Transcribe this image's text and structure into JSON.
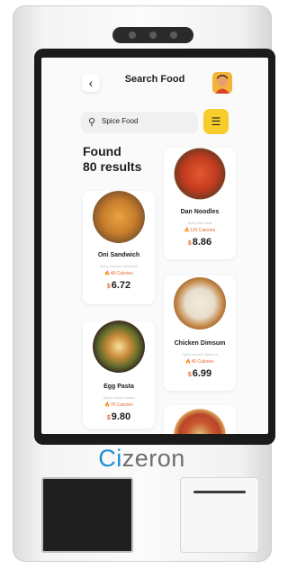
{
  "brand": {
    "prefix": "Ci",
    "rest": "zeron"
  },
  "header": {
    "title": "Search Food",
    "back_icon": "‹",
    "avatar": "user-avatar"
  },
  "search": {
    "value": "Spice Food",
    "icon": "⚲"
  },
  "filter": {
    "icon": "☰"
  },
  "results": {
    "line1": "Found",
    "line2": "80 results"
  },
  "currency": "$",
  "foods": [
    {
      "name": "Oni Sandwich",
      "desc": "Spicy chicken sandwich",
      "calories": "48 Calories",
      "price": "6.72"
    },
    {
      "name": "Dan Noodles",
      "desc": "Spicy fish meal",
      "calories": "120 Calories",
      "price": "8.86"
    },
    {
      "name": "Egg Pasta",
      "desc": "Spicy chicken pasta",
      "calories": "78 Calories",
      "price": "9.80"
    },
    {
      "name": "Chicken Dimsum",
      "desc": "Spicy chicken dimsum",
      "calories": "45 Calories",
      "price": "6.99"
    }
  ]
}
